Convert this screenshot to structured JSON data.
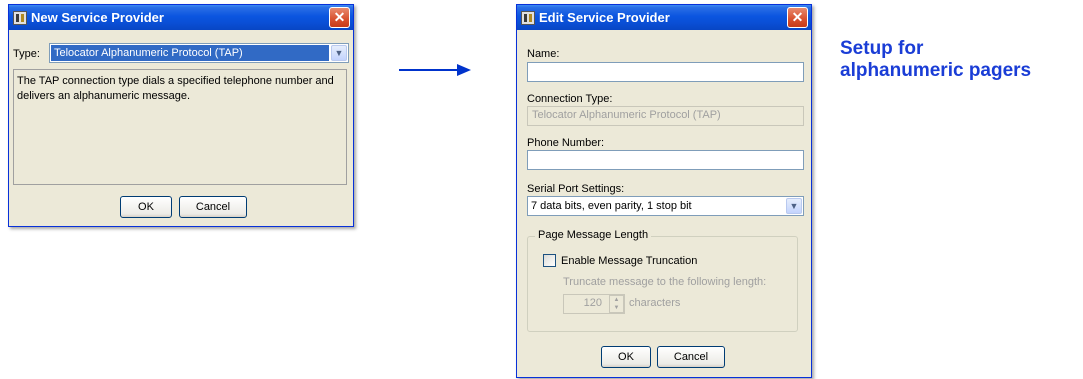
{
  "new_dialog": {
    "title": "New Service Provider",
    "type_label": "Type:",
    "type_value": "Telocator Alphanumeric Protocol (TAP)",
    "description": "The TAP connection type dials a specified telephone number and delivers an alphanumeric message.",
    "ok_label": "OK",
    "cancel_label": "Cancel"
  },
  "arrow": {
    "direction": "right",
    "color": "#0033cc"
  },
  "edit_dialog": {
    "title": "Edit Service Provider",
    "name_label": "Name:",
    "name_value": "",
    "connection_type_label": "Connection Type:",
    "connection_type_value": "Telocator Alphanumeric Protocol (TAP)",
    "phone_label": "Phone Number:",
    "phone_value": "",
    "serial_label": "Serial Port Settings:",
    "serial_value": "7 data bits, even parity, 1 stop bit",
    "group_title": "Page Message Length",
    "truncation_label": "Enable Message Truncation",
    "truncation_checked": false,
    "truncate_hint": "Truncate message to the following length:",
    "length_value": "120",
    "characters_label": "characters",
    "ok_label": "OK",
    "cancel_label": "Cancel"
  },
  "caption": {
    "line1": "Setup for",
    "line2": "alphanumeric pagers",
    "color": "#1a3dd6"
  },
  "icons": {
    "close": "close-icon",
    "dropdown": "chevron-down-icon",
    "app": "app-icon"
  }
}
